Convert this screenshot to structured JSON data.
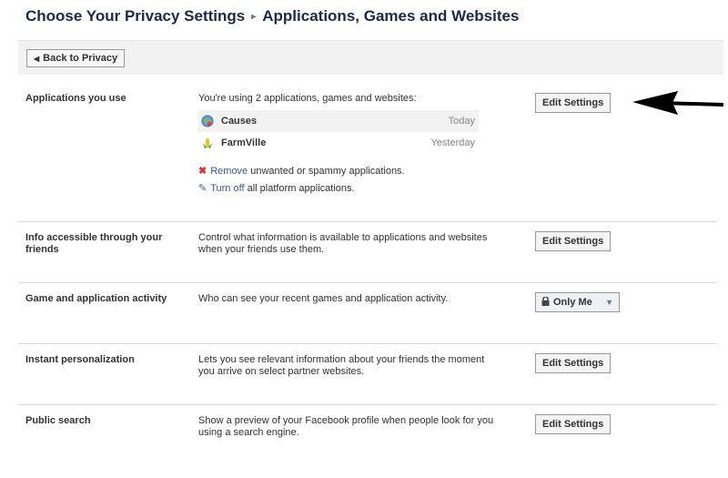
{
  "header": {
    "title": "Choose Your Privacy Settings",
    "separator": "▸",
    "subtitle": "Applications, Games and Websites"
  },
  "toolbar": {
    "back_label": "Back to Privacy"
  },
  "applications": {
    "label": "Applications you use",
    "summary": "You're using 2 applications, games and websites:",
    "apps": [
      {
        "name": "Causes",
        "time": "Today",
        "icon": "causes-app-icon"
      },
      {
        "name": "FarmVille",
        "time": "Yesterday",
        "icon": "farmville-app-icon"
      }
    ],
    "remove_link": "Remove",
    "remove_text": "unwanted or spammy applications.",
    "turnoff_link": "Turn off",
    "turnoff_text": "all platform applications.",
    "button": "Edit Settings"
  },
  "friends_info": {
    "label": "Info accessible through your friends",
    "desc": "Control what information is available to applications and websites when your friends use them.",
    "button": "Edit Settings"
  },
  "activity": {
    "label": "Game and application activity",
    "desc": "Who can see your recent games and application activity.",
    "dropdown": "Only Me"
  },
  "personalization": {
    "label": "Instant personalization",
    "desc": "Lets you see relevant information about your friends the moment you arrive on select partner websites.",
    "button": "Edit Settings"
  },
  "public_search": {
    "label": "Public search",
    "desc": "Show a preview of your Facebook profile when people look for you using a search engine.",
    "button": "Edit Settings"
  },
  "colors": {
    "title": "#1c2a47",
    "link": "#3b5998",
    "toolbar_bg": "#f2f2f2"
  }
}
